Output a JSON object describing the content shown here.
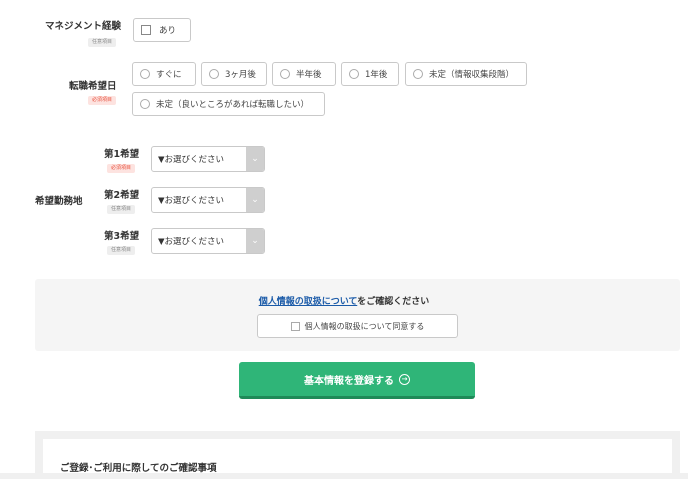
{
  "management": {
    "label": "マネジメント経験",
    "tag": "任意項目",
    "option": "あり"
  },
  "transfer_date": {
    "label": "転職希望日",
    "tag": "必須項目",
    "options": [
      "すぐに",
      "3ヶ月後",
      "半年後",
      "1年後",
      "未定（情報収集段階）",
      "未定（良いところがあれば転職したい）"
    ]
  },
  "location": {
    "label": "希望勤務地",
    "choices": [
      {
        "label": "第1希望",
        "tag": "必須項目",
        "value": "▼お選びください"
      },
      {
        "label": "第2希望",
        "tag": "任意項目",
        "value": "▼お選びください"
      },
      {
        "label": "第3希望",
        "tag": "任意項目",
        "value": "▼お選びください"
      }
    ]
  },
  "consent": {
    "link": "個人情報の取扱について",
    "suffix": "をご確認ください",
    "checkbox_label": "個人情報の取扱について同意する"
  },
  "submit_label": "基本情報を登録する",
  "submit_icon": "arrow-right-circle-icon",
  "notice_title": "ご登録･ご利用に際してのご確認事項",
  "colors": {
    "accent_green": "#2fb578",
    "required_red": "#e8523f",
    "link_blue": "#1a5aa8"
  }
}
